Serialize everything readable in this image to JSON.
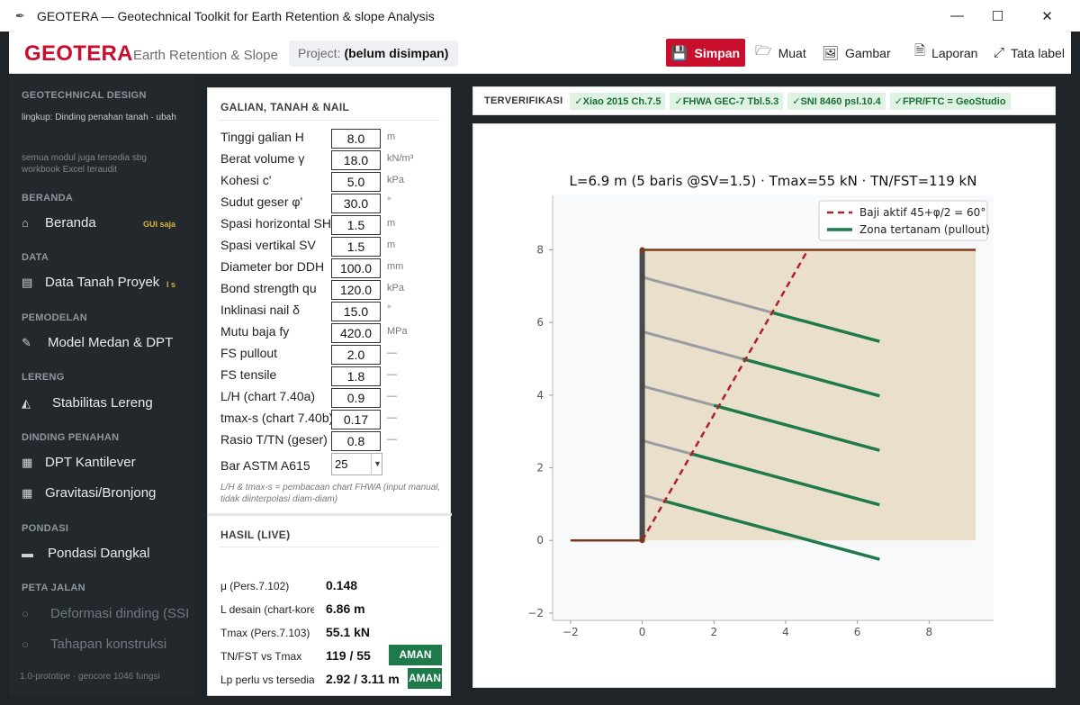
{
  "window": {
    "title": "GEOTERA — Geotechnical Toolkit for Earth Retention & slope Analysis",
    "minimize": "—",
    "maximize": "☐",
    "close": "✕"
  },
  "toolbar": {
    "brand": "GEOTERA",
    "brand_sub": "Earth Retention & Slope",
    "project_label": "Project:",
    "project_value": "(belum disimpan)",
    "save": "Simpan",
    "load": "Muat",
    "image": "Gambar",
    "report": "Laporan",
    "labels": "Tata label"
  },
  "sidebar": {
    "header": "GEOTECHNICAL DESIGN",
    "scope": "lingkup: Dinding penahan tanah · ubah",
    "note": "semua modul juga tersedia sbg workbook Excel teraudit",
    "sections": {
      "beranda": "BERANDA",
      "data": "DATA",
      "pemodelan": "PEMODELAN",
      "lereng": "LERENG",
      "dinding": "DINDING PENAHAN",
      "pondasi": "PONDASI",
      "peta": "PETA JALAN"
    },
    "items": {
      "beranda": "Beranda",
      "beranda_tag": "GUI saja",
      "data_tanah": "Data Tanah Proyek",
      "data_tanah_tag": "l s",
      "model": "Model Medan & DPT",
      "stabilitas": "Stabilitas Lereng",
      "kantilever": "DPT Kantilever",
      "gravitasi": "Gravitasi/Bronjong",
      "pondasi": "Pondasi Dangkal",
      "deformasi": "Deformasi dinding (SSI",
      "tahapan": "Tahapan konstruksi"
    },
    "footer": "1.0-prototipe · geocore 1046 fungsi"
  },
  "inputs": {
    "heading": "GALIAN, TANAH & NAIL",
    "fields": [
      {
        "label": "Tinggi galian H",
        "value": "8.0",
        "unit": "m"
      },
      {
        "label": "Berat volume γ",
        "value": "18.0",
        "unit": "kN/m³"
      },
      {
        "label": "Kohesi c'",
        "value": "5.0",
        "unit": "kPa"
      },
      {
        "label": "Sudut geser φ'",
        "value": "30.0",
        "unit": "°"
      },
      {
        "label": "Spasi horizontal SH",
        "value": "1.5",
        "unit": "m"
      },
      {
        "label": "Spasi vertikal SV",
        "value": "1.5",
        "unit": "m"
      },
      {
        "label": "Diameter bor DDH",
        "value": "100.0",
        "unit": "mm"
      },
      {
        "label": "Bond strength qu",
        "value": "120.0",
        "unit": "kPa"
      },
      {
        "label": "Inklinasi nail δ",
        "value": "15.0",
        "unit": "°"
      },
      {
        "label": "Mutu baja fy",
        "value": "420.0",
        "unit": "MPa"
      },
      {
        "label": "FS pullout",
        "value": "2.0",
        "unit": "—"
      },
      {
        "label": "FS tensile",
        "value": "1.8",
        "unit": "—"
      },
      {
        "label": "L/H (chart 7.40a)",
        "value": "0.9",
        "unit": "—"
      },
      {
        "label": "tmax-s (chart 7.40b)",
        "value": "0.17",
        "unit": "—"
      },
      {
        "label": "Rasio T/TN (geser)",
        "value": "0.8",
        "unit": "—"
      }
    ],
    "bar_label": "Bar ASTM A615",
    "bar_value": "25",
    "note": "L/H & tmax-s = pembacaan chart FHWA (input manual, tidak diinterpolasi diam-diam)"
  },
  "results": {
    "heading": "HASIL (LIVE)",
    "rows": [
      {
        "label": "μ (Pers.7.102)",
        "value": "0.148"
      },
      {
        "label": "L desain (chart-korek",
        "value": "6.86 m"
      },
      {
        "label": "Tmax (Pers.7.103)",
        "value": "55.1 kN"
      },
      {
        "label": "TN/FST vs Tmax",
        "value": "119 / 55",
        "badge": "AMAN"
      },
      {
        "label": "Lp perlu vs tersedia",
        "value": "2.92 / 3.11 m",
        "badge": "AMAN"
      }
    ]
  },
  "verification": {
    "label": "TERVERIFIKASI",
    "tags": [
      "✓Xiao 2015 Ch.7.5",
      "✓FHWA GEC-7 Tbl.5.3",
      "✓SNI 8460 psl.10.4",
      "✓FPR/FTC = GeoStudio"
    ]
  },
  "chart_data": {
    "type": "line",
    "title": "L=6.9 m (5 baris @SV=1.5) · Tmax=55 kN · TN/FST=119 kN",
    "xlim": [
      -2.5,
      9.8
    ],
    "ylim": [
      -2.2,
      9.5
    ],
    "xticks": [
      -2,
      0,
      2,
      4,
      6,
      8
    ],
    "yticks": [
      -2,
      0,
      2,
      4,
      6,
      8
    ],
    "tick_labels_x": [
      "−2",
      "0",
      "2",
      "4",
      "6",
      "8"
    ],
    "tick_labels_y": [
      "−2",
      "0",
      "2",
      "4",
      "6",
      "8"
    ],
    "legend_position": "top-right",
    "legend": [
      "Baji aktif 45+φ/2 = 60°",
      "Zona tertanam (pullout)"
    ],
    "soil_block": {
      "x": [
        0,
        9.3
      ],
      "y": [
        0,
        8
      ]
    },
    "ground_line": {
      "x": [
        0,
        9.3
      ],
      "y": [
        8,
        8
      ]
    },
    "excavation_line": {
      "x": [
        -2,
        0
      ],
      "y": [
        0,
        0
      ]
    },
    "wall": {
      "x": [
        0,
        0
      ],
      "y": [
        0,
        8
      ]
    },
    "wedge": {
      "x": [
        0,
        4.62
      ],
      "y": [
        0,
        8
      ]
    },
    "nails": [
      {
        "y0": 7.25,
        "x_break": 3.6,
        "y_break": 6.28,
        "x1": 6.62,
        "y1": 5.48
      },
      {
        "y0": 5.75,
        "x_break": 2.8,
        "y_break": 5.0,
        "x1": 6.62,
        "y1": 3.98
      },
      {
        "y0": 4.25,
        "x_break": 2.0,
        "y_break": 3.72,
        "x1": 6.62,
        "y1": 2.48
      },
      {
        "y0": 2.75,
        "x_break": 1.35,
        "y_break": 2.39,
        "x1": 6.62,
        "y1": 0.98
      },
      {
        "y0": 1.25,
        "x_break": 0.6,
        "y_break": 1.09,
        "x1": 6.62,
        "y1": -0.52
      }
    ],
    "colors": {
      "soil": "#eadfca",
      "ground": "#7a3b1b",
      "wall": "#4a4a4a",
      "wedge": "#b01e2e",
      "nail_free": "#9a9ca3",
      "nail_bonded": "#1e7a4a"
    }
  }
}
